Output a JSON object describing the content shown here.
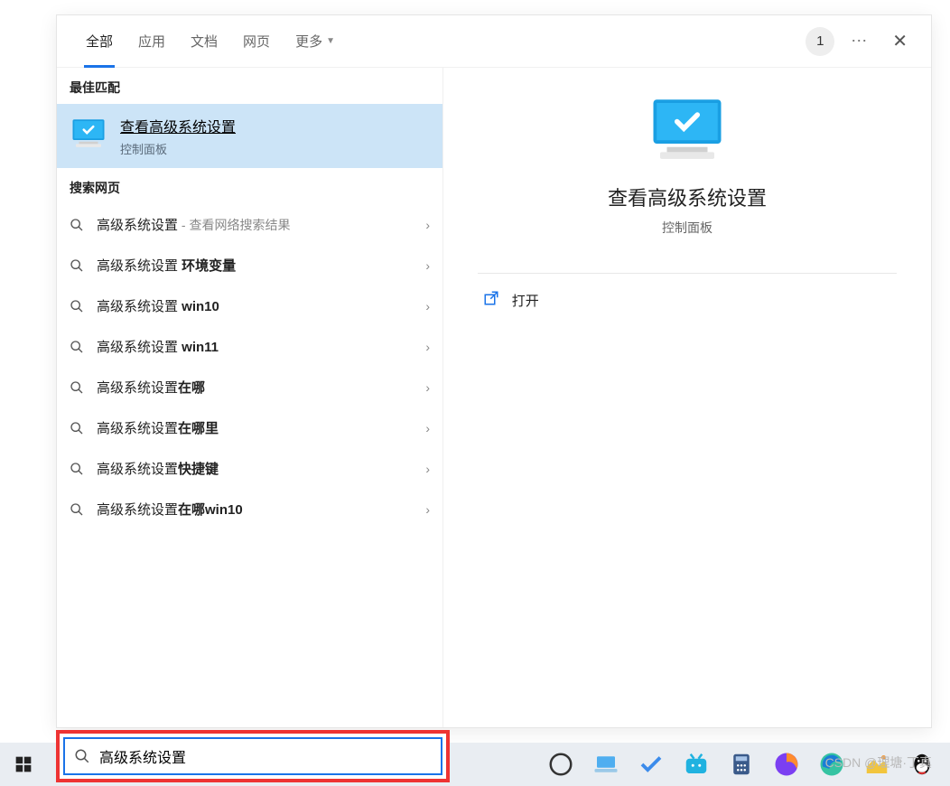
{
  "tabs": {
    "all": "全部",
    "apps": "应用",
    "docs": "文档",
    "web": "网页",
    "more": "更多",
    "badge": "1"
  },
  "sections": {
    "best_match": "最佳匹配",
    "web_search": "搜索网页"
  },
  "best_match": {
    "title": "查看高级系统设置",
    "subtitle": "控制面板"
  },
  "web_results": [
    {
      "prefix": "高级系统设置",
      "bold": "",
      "hint": " - 查看网络搜索结果"
    },
    {
      "prefix": "高级系统设置 ",
      "bold": "环境变量",
      "hint": ""
    },
    {
      "prefix": "高级系统设置 ",
      "bold": "win10",
      "hint": ""
    },
    {
      "prefix": "高级系统设置 ",
      "bold": "win11",
      "hint": ""
    },
    {
      "prefix": "高级系统设置",
      "bold": "在哪",
      "hint": ""
    },
    {
      "prefix": "高级系统设置",
      "bold": "在哪里",
      "hint": ""
    },
    {
      "prefix": "高级系统设置",
      "bold": "快捷键",
      "hint": ""
    },
    {
      "prefix": "高级系统设置",
      "bold": "在哪win10",
      "hint": ""
    }
  ],
  "preview": {
    "title": "查看高级系统设置",
    "subtitle": "控制面板",
    "open": "打开"
  },
  "search": {
    "value": "高级系统设置"
  },
  "watermark": "CSDN @理塘·丁真",
  "colors": {
    "accent": "#1a73e8",
    "highlight": "#cce4f7",
    "box": "#e33"
  }
}
